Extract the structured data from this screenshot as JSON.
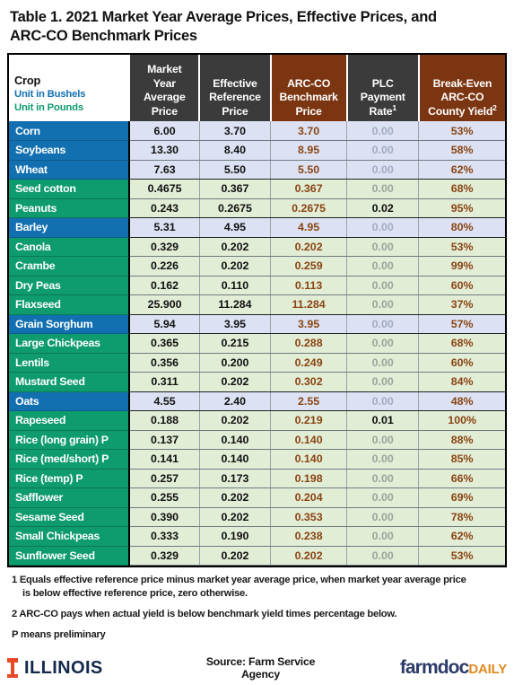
{
  "title": {
    "line1": "Table 1.  2021 Market Year Average Prices, Effective Prices, and",
    "line2": "ARC-CO Benchmark Prices"
  },
  "table": {
    "headers": {
      "crop": {
        "main": "Crop",
        "bushels": "Unit in Bushels",
        "pounds": "Unit in Pounds"
      },
      "market_year_average_price": [
        "Market",
        "Year",
        "Average",
        "Price"
      ],
      "effective_reference_price": [
        "Effective",
        "Reference",
        "Price"
      ],
      "arc_co_benchmark_price": [
        "ARC-CO",
        "Benchmark",
        "Price"
      ],
      "plc_payment_rate": [
        "PLC",
        "Payment",
        "Rate"
      ],
      "plc_payment_rate_footnote": "1",
      "break_even_arc_co_county_yield": [
        "Break-Even",
        "ARC-CO",
        "County Yield"
      ],
      "break_even_footnote": "2"
    },
    "rows": [
      {
        "crop": "Corn",
        "unit": "bushel",
        "myap": "6.00",
        "erp": "3.70",
        "arc": "3.70",
        "plc": "0.00",
        "plc_bold": false,
        "bey": "53%",
        "group_end": false
      },
      {
        "crop": "Soybeans",
        "unit": "bushel",
        "myap": "13.30",
        "erp": "8.40",
        "arc": "8.95",
        "plc": "0.00",
        "plc_bold": false,
        "bey": "58%",
        "group_end": false
      },
      {
        "crop": "Wheat",
        "unit": "bushel",
        "myap": "7.63",
        "erp": "5.50",
        "arc": "5.50",
        "plc": "0.00",
        "plc_bold": false,
        "bey": "62%",
        "group_end": true
      },
      {
        "crop": "Seed cotton",
        "unit": "pound",
        "myap": "0.4675",
        "erp": "0.367",
        "arc": "0.367",
        "plc": "0.00",
        "plc_bold": false,
        "bey": "68%",
        "group_end": false
      },
      {
        "crop": "Peanuts",
        "unit": "pound",
        "myap": "0.243",
        "erp": "0.2675",
        "arc": "0.2675",
        "plc": "0.02",
        "plc_bold": true,
        "bey": "95%",
        "group_end": true
      },
      {
        "crop": "Barley",
        "unit": "bushel",
        "myap": "5.31",
        "erp": "4.95",
        "arc": "4.95",
        "plc": "0.00",
        "plc_bold": false,
        "bey": "80%",
        "group_end": true
      },
      {
        "crop": "Canola",
        "unit": "pound",
        "myap": "0.329",
        "erp": "0.202",
        "arc": "0.202",
        "plc": "0.00",
        "plc_bold": false,
        "bey": "53%",
        "group_end": false
      },
      {
        "crop": "Crambe",
        "unit": "pound",
        "myap": "0.226",
        "erp": "0.202",
        "arc": "0.259",
        "plc": "0.00",
        "plc_bold": false,
        "bey": "99%",
        "group_end": false
      },
      {
        "crop": "Dry Peas",
        "unit": "pound",
        "myap": "0.162",
        "erp": "0.110",
        "arc": "0.113",
        "plc": "0.00",
        "plc_bold": false,
        "bey": "60%",
        "group_end": false
      },
      {
        "crop": "Flaxseed",
        "unit": "pound",
        "myap": "25.900",
        "erp": "11.284",
        "arc": "11.284",
        "plc": "0.00",
        "plc_bold": false,
        "bey": "37%",
        "group_end": true
      },
      {
        "crop": "Grain Sorghum",
        "unit": "bushel",
        "myap": "5.94",
        "erp": "3.95",
        "arc": "3.95",
        "plc": "0.00",
        "plc_bold": false,
        "bey": "57%",
        "group_end": true
      },
      {
        "crop": "Large Chickpeas",
        "unit": "pound",
        "myap": "0.365",
        "erp": "0.215",
        "arc": "0.288",
        "plc": "0.00",
        "plc_bold": false,
        "bey": "68%",
        "group_end": false
      },
      {
        "crop": "Lentils",
        "unit": "pound",
        "myap": "0.356",
        "erp": "0.200",
        "arc": "0.249",
        "plc": "0.00",
        "plc_bold": false,
        "bey": "60%",
        "group_end": false
      },
      {
        "crop": "Mustard Seed",
        "unit": "pound",
        "myap": "0.311",
        "erp": "0.202",
        "arc": "0.302",
        "plc": "0.00",
        "plc_bold": false,
        "bey": "84%",
        "group_end": true
      },
      {
        "crop": "Oats",
        "unit": "bushel",
        "myap": "4.55",
        "erp": "2.40",
        "arc": "2.55",
        "plc": "0.00",
        "plc_bold": false,
        "bey": "48%",
        "group_end": true
      },
      {
        "crop": "Rapeseed",
        "unit": "pound",
        "myap": "0.188",
        "erp": "0.202",
        "arc": "0.219",
        "plc": "0.01",
        "plc_bold": true,
        "bey": "100%",
        "group_end": false
      },
      {
        "crop": "Rice (long grain) P",
        "unit": "pound",
        "myap": "0.137",
        "erp": "0.140",
        "arc": "0.140",
        "plc": "0.00",
        "plc_bold": false,
        "bey": "88%",
        "group_end": false
      },
      {
        "crop": "Rice (med/short) P",
        "unit": "pound",
        "myap": "0.141",
        "erp": "0.140",
        "arc": "0.140",
        "plc": "0.00",
        "plc_bold": false,
        "bey": "85%",
        "group_end": false
      },
      {
        "crop": "Rice (temp) P",
        "unit": "pound",
        "myap": "0.257",
        "erp": "0.173",
        "arc": "0.198",
        "plc": "0.00",
        "plc_bold": false,
        "bey": "66%",
        "group_end": false
      },
      {
        "crop": "Safflower",
        "unit": "pound",
        "myap": "0.255",
        "erp": "0.202",
        "arc": "0.204",
        "plc": "0.00",
        "plc_bold": false,
        "bey": "69%",
        "group_end": false
      },
      {
        "crop": "Sesame Seed",
        "unit": "pound",
        "myap": "0.390",
        "erp": "0.202",
        "arc": "0.353",
        "plc": "0.00",
        "plc_bold": false,
        "bey": "78%",
        "group_end": false
      },
      {
        "crop": "Small Chickpeas",
        "unit": "pound",
        "myap": "0.333",
        "erp": "0.190",
        "arc": "0.238",
        "plc": "0.00",
        "plc_bold": false,
        "bey": "62%",
        "group_end": false
      },
      {
        "crop": "Sunflower Seed",
        "unit": "pound",
        "myap": "0.329",
        "erp": "0.202",
        "arc": "0.202",
        "plc": "0.00",
        "plc_bold": false,
        "bey": "53%",
        "group_end": false
      }
    ]
  },
  "notes": {
    "note1_line1": "1 Equals effective reference price minus market year average price, when market year average price",
    "note1_line2": "is below effective reference price, zero otherwise.",
    "note2": "2 ARC-CO pays when actual yield is below benchmark yield times percentage below.",
    "note3": "P means preliminary"
  },
  "footer": {
    "illinois_logo_text": "ILLINOIS",
    "source": "Source:  Farm Service Agency",
    "farmdoc_primary": "farmdoc",
    "farmdoc_secondary": "DAILY"
  },
  "colors": {
    "bushel_blue": "#1270B0",
    "pound_green": "#0E9B6E",
    "header_gray": "#3B3B3B",
    "header_brown": "#7B3510",
    "value_brown": "#8A4413",
    "illinois_orange": "#E84A27",
    "illinois_navy": "#13294B",
    "farmdoc_navy": "#2B3A67",
    "farmdoc_orange": "#E08A1E"
  }
}
